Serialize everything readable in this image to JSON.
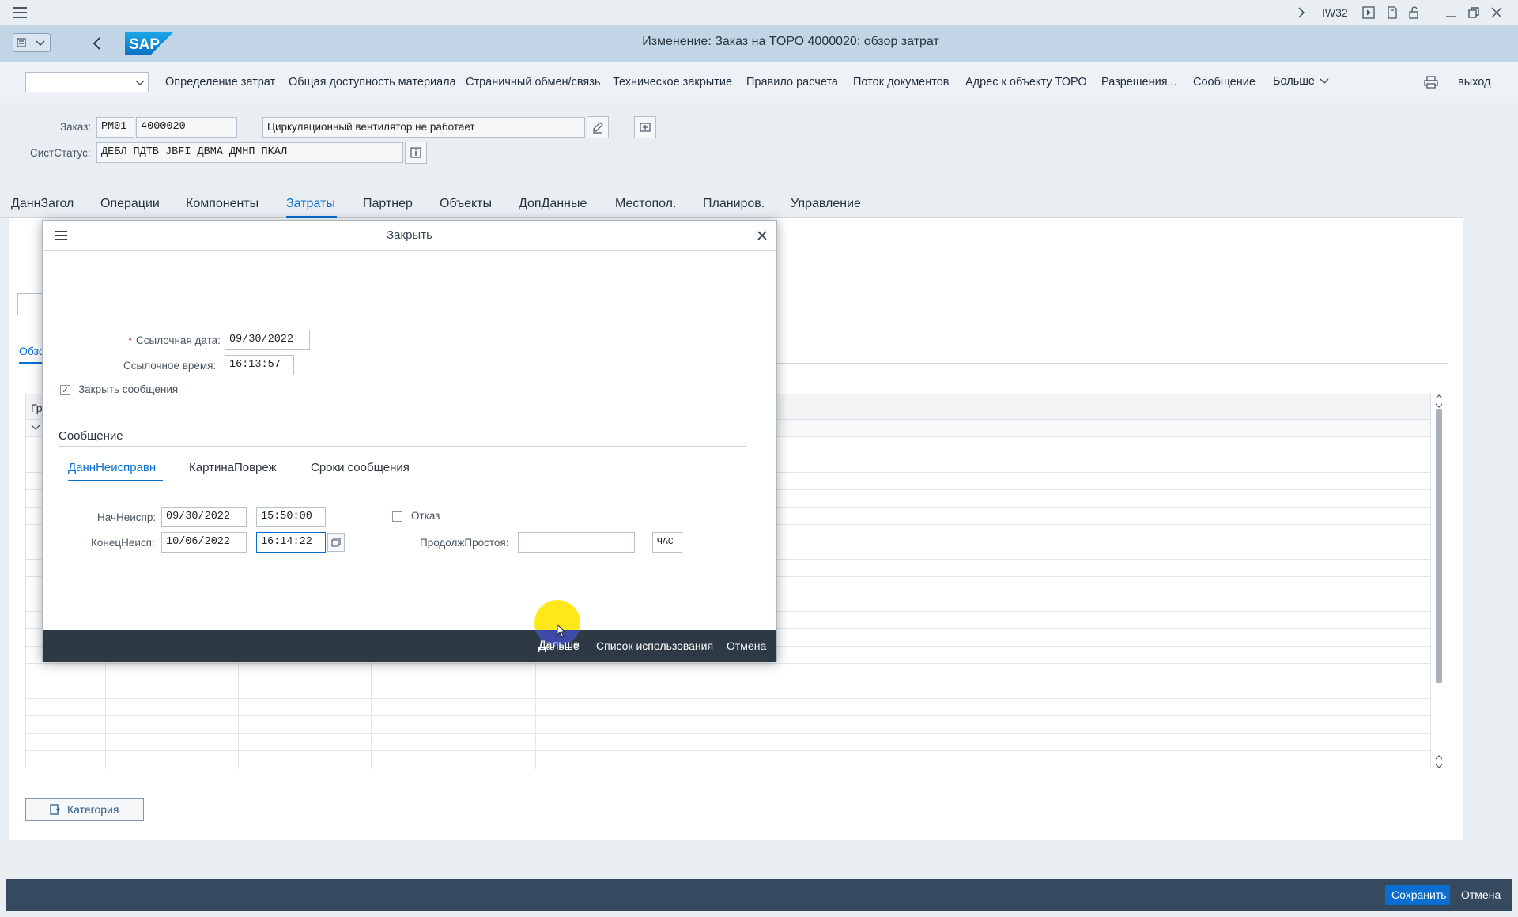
{
  "window": {
    "transaction": "IW32",
    "title": "Изменение: Заказ на ТОРО 4000020: обзор затрат"
  },
  "toolbar": {
    "dropdown_value": "",
    "links": [
      "Определение затрат",
      "Общая доступность материала",
      "Страничный обмен/связь",
      "Техническое закрытие",
      "Правило расчета",
      "Поток документов",
      "Адрес к объекту ТОРО",
      "Разрешения...",
      "Сообщение",
      "Больше"
    ],
    "exit_label": "выход"
  },
  "order": {
    "order_label": "Заказ:",
    "order_type": "PM01",
    "order_number": "4000020",
    "description": "Циркуляционный вентилятор не работает",
    "status_label": "СистСтатус:",
    "status_value": "ДЕБЛ ПДТВ JBFI ДВМА ДМНП ПКАЛ"
  },
  "tabs": [
    "ДаннЗагол",
    "Операции",
    "Компоненты",
    "Затраты",
    "Партнер",
    "Объекты",
    "ДопДанные",
    "Местопол.",
    "Планиров.",
    "Управление"
  ],
  "active_tab": "Затраты",
  "background": {
    "overview_tab_partial": "Обзо",
    "column_partial": "Гр",
    "category_button": "Категория"
  },
  "dialog": {
    "title": "Закрыть",
    "ref_date_label": "Ссылочная дата:",
    "ref_date_value": "09/30/2022",
    "ref_time_label": "Ссылочное время:",
    "ref_time_value": "16:13:57",
    "close_notif_label": "Закрыть сообщения",
    "close_notif_checked": true,
    "section_title": "Сообщение",
    "subtabs": [
      "ДаннНеисправн",
      "КартинаПовреж",
      "Сроки сообщения"
    ],
    "active_subtab": "ДаннНеисправн",
    "malfunction_start_label": "НачНеиспр:",
    "malfunction_start_date": "09/30/2022",
    "malfunction_start_time": "15:50:00",
    "malfunction_end_label": "КонецНеисп:",
    "malfunction_end_date": "10/06/2022",
    "malfunction_end_time": "16:14:22",
    "breakdown_label": "Отказ",
    "breakdown_checked": false,
    "downtime_label": "ПродолжПростоя:",
    "downtime_value": "",
    "downtime_unit": "ЧАС",
    "buttons": {
      "continue": "Дальше",
      "where_used": "Список использования",
      "cancel": "Отмена"
    }
  },
  "footer": {
    "save": "Сохранить",
    "cancel": "Отмена"
  },
  "colors": {
    "header_bg": "#c2d5e6",
    "footer_bg": "#354a5f",
    "accent": "#0a6ed1",
    "save_btn": "#0a6ed1",
    "cursor_highlight": "#ffe600"
  }
}
